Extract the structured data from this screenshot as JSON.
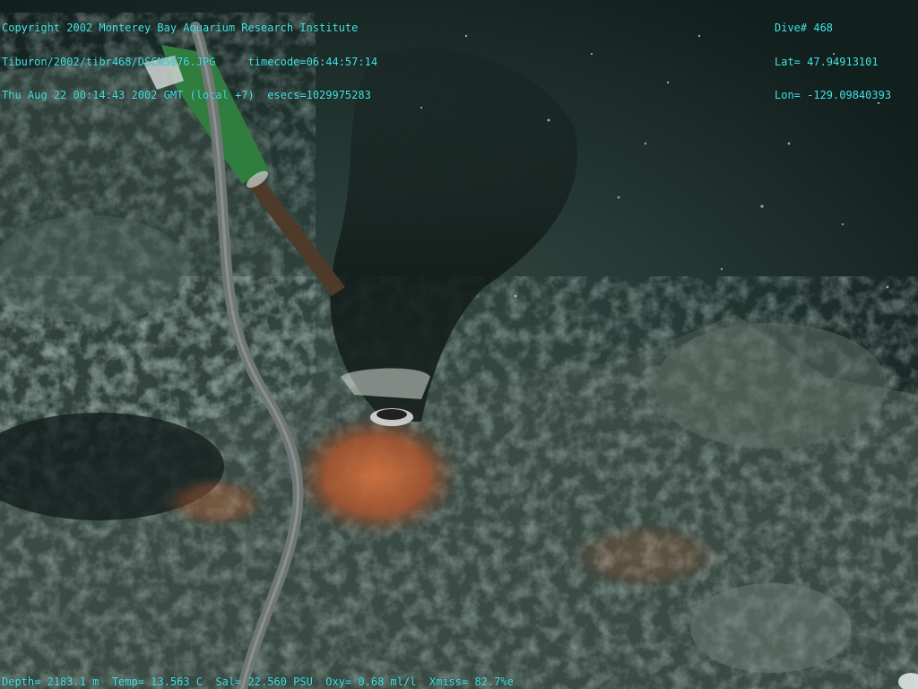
{
  "header_left": {
    "line1": "Copyright 2002 Monterey Bay Aquarium Research Institute",
    "line2a": "Tiburon/2002/tibr468/DSCN5076.JPG",
    "line2b": "timecode=06:44:57:14",
    "line3a": "Thu Aug 22 00:14:43 2002 GMT (local +7)",
    "line3b": "esecs=1029975283"
  },
  "header_right": {
    "dive": "Dive# 468",
    "lat": "Lat= 47.94913101",
    "lon": "Lon= -129.09840393"
  },
  "footer": {
    "depth": "Depth= 2183.1 m",
    "temp": "Temp= 13.563 C",
    "sal": "Sal= 22.560 PSU",
    "oxy": "Oxy= 0.68 ml/l",
    "xmiss": "Xmiss= 82.7%e"
  },
  "colors": {
    "overlay_text": "#46e6e6",
    "water": "#0e2420",
    "sediment": "#3c4f48",
    "orange_growth": "#c8642e",
    "green_hose": "#2a7a3a"
  }
}
